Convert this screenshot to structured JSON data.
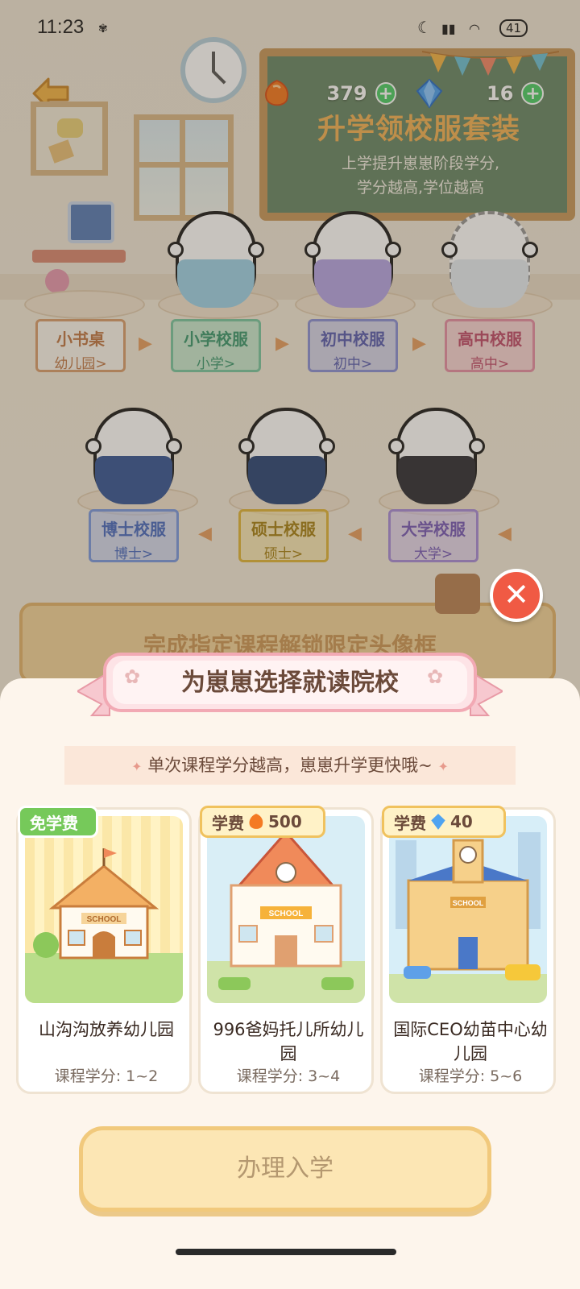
{
  "status_bar": {
    "time": "11:23",
    "battery": "41"
  },
  "currencies": [
    {
      "icon": "orange-gem-icon",
      "value": "379"
    },
    {
      "icon": "blue-diamond-icon",
      "value": "16"
    }
  ],
  "board": {
    "title": "升学领校服套装",
    "subtitle_line1": "上学提升崽崽阶段学分,",
    "subtitle_line2": "学分越高,学位越高"
  },
  "stages_row1": [
    {
      "title": "小书桌",
      "sub": "幼儿园>",
      "color": "#d9a070"
    },
    {
      "title": "小学校服",
      "sub": "小学>",
      "color": "#7cc7a2"
    },
    {
      "title": "初中校服",
      "sub": "初中>",
      "color": "#8d92d6"
    },
    {
      "title": "高中校服",
      "sub": "高中>",
      "color": "#e591a7"
    }
  ],
  "stages_row2": [
    {
      "title": "博士校服",
      "sub": "博士>",
      "color": "#7d9be0"
    },
    {
      "title": "硕士校服",
      "sub": "硕士>",
      "color": "#e0b73e"
    },
    {
      "title": "大学校服",
      "sub": "大学>",
      "color": "#a98fd8"
    }
  ],
  "background_banner": "完成指定课程解锁限定头像框",
  "sheet": {
    "title": "为崽崽选择就读院校",
    "hint": "单次课程学分越高，崽崽升学更快哦~"
  },
  "schools": [
    {
      "tag": "免学费",
      "tag_type": "free",
      "name": "山沟沟放养幼儿园",
      "credit": "课程学分: 1~2"
    },
    {
      "tag": "学费",
      "tag_type": "fee",
      "fee_icon": "orange-gem-icon",
      "fee": "500",
      "name": "996爸妈托儿所幼儿园",
      "credit": "课程学分: 3~4"
    },
    {
      "tag": "学费",
      "tag_type": "fee",
      "fee_icon": "blue-diamond-icon",
      "fee": "40",
      "name": "国际CEO幼苗中心幼儿园",
      "credit": "课程学分: 5~6"
    }
  ],
  "enroll_button": "办理入学",
  "colors": {
    "accent_red": "#f05a44",
    "free_green": "#76c95a",
    "button_yellow": "#fce6b4"
  }
}
